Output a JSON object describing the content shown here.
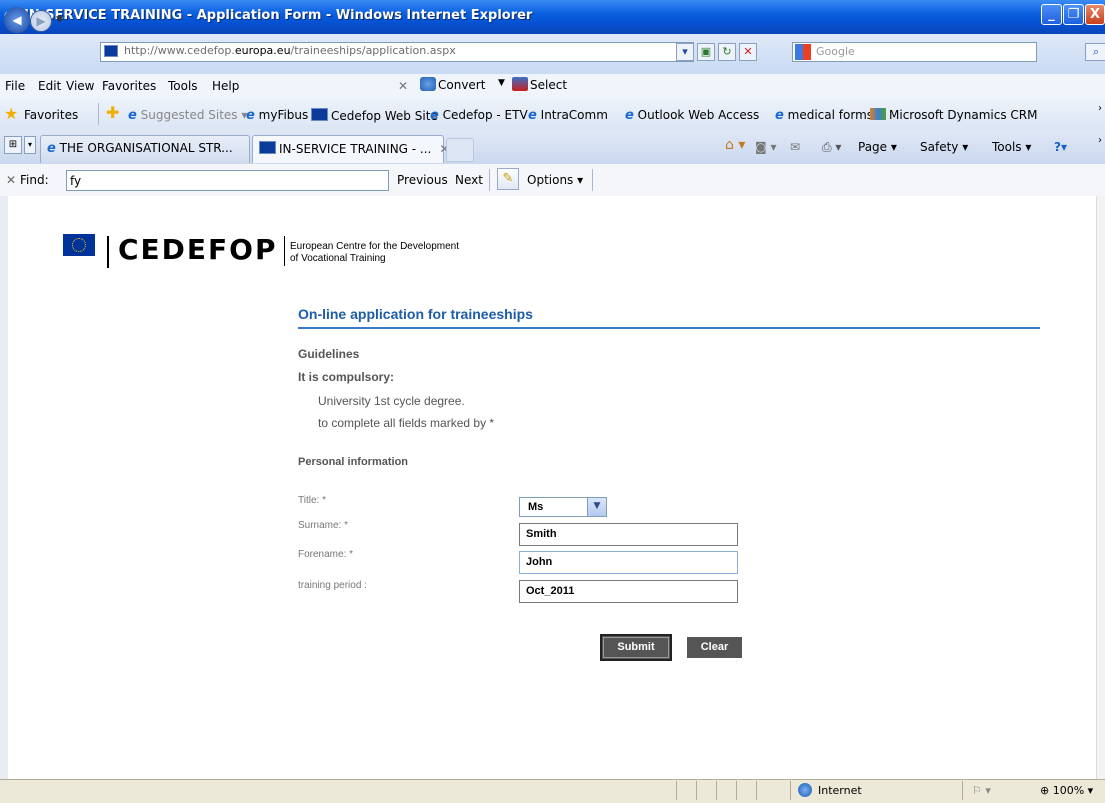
{
  "window": {
    "title": "IN-SERVICE TRAINING - Application Form - Windows Internet Explorer",
    "min": "_",
    "max": "❐",
    "close": "X"
  },
  "address": {
    "url_prefix": "http://www.cedefop.",
    "url_domain": "europa.eu",
    "url_path": "/traineeships/application.aspx",
    "search_placeholder": "Google"
  },
  "menu": {
    "file": "File",
    "edit": "Edit",
    "view": "View",
    "favorites": "Favorites",
    "tools": "Tools",
    "help": "Help",
    "convert": "Convert",
    "select": "Select"
  },
  "favorites_bar": {
    "label": "Favorites",
    "links": [
      "Suggested Sites ▾",
      "myFibus",
      "Cedefop Web Site",
      "Cedefop - ETV",
      "IntraComm",
      "Outlook Web Access",
      "medical forms",
      "Microsoft Dynamics CRM"
    ]
  },
  "tabs": [
    {
      "label": "THE ORGANISATIONAL STR..."
    },
    {
      "label": "IN-SERVICE TRAINING - ..."
    }
  ],
  "commands": {
    "page": "Page ▾",
    "safety": "Safety ▾",
    "tools": "Tools ▾"
  },
  "find": {
    "label": "Find:",
    "value": "fy",
    "previous": "Previous",
    "next": "Next",
    "options": "Options ▾"
  },
  "page": {
    "logo": "CEDEFOP",
    "tagline_line1": "European Centre for the Development",
    "tagline_line2": "of Vocational Training",
    "heading": "On-line application for traineeships",
    "guidelines": "Guidelines",
    "compulsory": "It is compulsory:",
    "requirements": [
      "University 1st cycle degree.",
      "to complete all fields marked by *"
    ],
    "section": "Personal information",
    "form": {
      "title_label": "Title: *",
      "title_value": "Ms",
      "surname_label": "Surname: *",
      "surname_value": "Smith",
      "forename_label": "Forename: *",
      "forename_value": "John",
      "period_label": "training period :",
      "period_value": "Oct_2011",
      "submit": "Submit",
      "clear": "Clear"
    }
  },
  "status": {
    "zone": "Internet",
    "zoom": "100%"
  }
}
